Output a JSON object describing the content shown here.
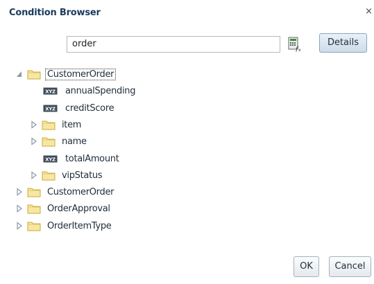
{
  "dialog": {
    "title": "Condition Browser",
    "close_label": "×"
  },
  "search": {
    "value": "order"
  },
  "toolbar": {
    "expression_icon": "expression-builder-icon",
    "details_label": "Details"
  },
  "tree": {
    "root": {
      "label": "CustomerOrder",
      "expanded": true,
      "children": [
        {
          "label": "annualSpending",
          "type": "field"
        },
        {
          "label": "creditScore",
          "type": "field"
        },
        {
          "label": "item",
          "type": "folder"
        },
        {
          "label": "name",
          "type": "folder"
        },
        {
          "label": "totalAmount",
          "type": "field"
        },
        {
          "label": "vipStatus",
          "type": "folder"
        }
      ]
    },
    "siblings": [
      {
        "label": "CustomerOrder"
      },
      {
        "label": "OrderApproval"
      },
      {
        "label": "OrderItemType"
      }
    ]
  },
  "footer": {
    "ok_label": "OK",
    "cancel_label": "Cancel"
  },
  "colors": {
    "title": "#1b3a5c",
    "folder_fill": "#f7e7a3",
    "folder_stroke": "#c9a83b",
    "details_bg": "#d6e3f0"
  }
}
